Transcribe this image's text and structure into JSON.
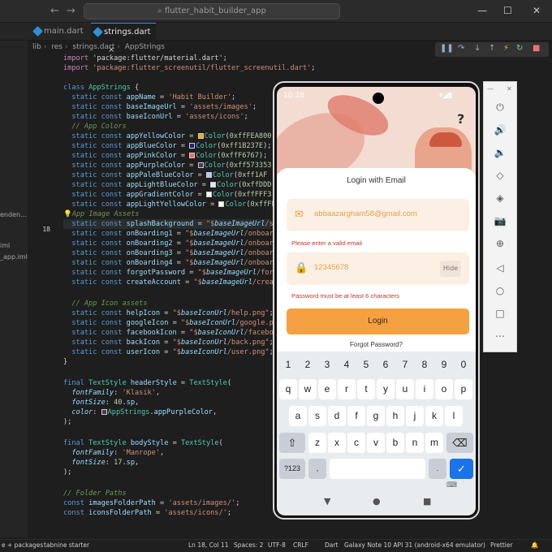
{
  "window": {
    "title": "flutter_habit_builder_app",
    "nav_back": "←",
    "nav_fwd": "→",
    "ctrl_min": "—",
    "ctrl_max": "☐",
    "ctrl_close": "✕"
  },
  "tabs": [
    {
      "label": "main.dart",
      "active": false
    },
    {
      "label": "strings.dart",
      "active": true,
      "close": "×"
    }
  ],
  "breadcrumb": [
    "lib",
    "res",
    "strings.dart",
    "AppStrings"
  ],
  "sidebar_items": [
    "enden...",
    "iml",
    "_app.iml"
  ],
  "editor": {
    "line_numbers": [
      "18"
    ],
    "code": [
      "import 'package:flutter/material.dart';",
      "import 'package:flutter_screenutil/flutter_screenutil.dart';",
      "",
      "class AppStrings {",
      "  static const appName = 'Habit Builder';",
      "  static const baseImageUrl = 'assets/images';",
      "  static const baseIconUrl = 'assets/icons';",
      "  // App Colors",
      "  static const appYellowColor = Color(0xffFEA800",
      "  static const appBlueColor = Color(0xff1B237E);",
      "  static const appPinkColor = Color(0xffF6767);",
      "  static const appPurpleColor = Color(0xff573353",
      "  static const appPaleBlueColor = Color(0xff1AF",
      "  static const appLightBlueColor = Color(0xffDDD",
      "  static const appGradientColor = Color(0xffFFF3",
      "  static const appLightYellowColor = Color(0xffFFF",
      "  // App Image Assets",
      "  static const splashBackground = \"$baseImageUrl/sp",
      "  static const onBoarding1 = \"$baseImageUrl/onboard",
      "  static const onBoarding2 = \"$baseImageUrl/onboard",
      "  static const onBoarding3 = \"$baseImageUrl/onboard",
      "  static const onBoarding4 = \"$baseImageUrl/onboard",
      "  static const forgotPassword = \"$baseImageUrl/forg",
      "  static const createAccount = \"$baseImageUrl/creat",
      "",
      "  // App Icon assets",
      "  static const helpIcon = \"$baseIconUrl/help.png\";",
      "  static const googleIcon = \"$baseIconUrl/google.pn",
      "  static const facebookIcon = \"$baseIconUrl/faceboo",
      "  static const backIcon = \"$baseIconUrl/back.png\";",
      "  static const userIcon = \"$baseIconUrl/user.png\";",
      "}",
      "",
      "final TextStyle headerStyle = TextStyle(",
      "  fontFamily: 'Klasik',",
      "  fontSize: 40.sp,",
      "  color: AppStrings.appPurpleColor,",
      ");",
      "",
      "final TextStyle bodyStyle = TextStyle(",
      "  fontFamily: 'Manrope',",
      "  fontSize: 17.sp,",
      ");",
      "",
      "// Folder Paths",
      "const imagesFolderPath = 'assets/images/';",
      "const iconsFolderPath = 'assets/icons/';"
    ]
  },
  "status_bar": {
    "left": "e + packages",
    "tabnine": "tabnine starter",
    "position": "Ln 18, Col 11",
    "spaces": "Spaces: 2",
    "encoding": "UTF-8",
    "eol": "CRLF",
    "language": "Dart",
    "device": "Galaxy Note 10 API 31 (android-x64 emulator)",
    "prettier": "Prettier"
  },
  "emulator_tools": [
    "⏻",
    "🔊",
    "🔉",
    "◇",
    "◈",
    "📷",
    "⊕",
    "◁",
    "○",
    "□",
    "⋯"
  ],
  "phone": {
    "time": "10:28",
    "help_icon": "?",
    "card_title": "Login with Email",
    "email_value": "abbaazargham58@gmail.com",
    "email_error": "Please enter a valid email",
    "password_value": "12345678",
    "hide_label": "Hide",
    "password_error": "Password must be at least 6 characters",
    "login_label": "Login",
    "forgot_label": "Forgot Password?",
    "keyboard": {
      "numbers": [
        "1",
        "2",
        "3",
        "4",
        "5",
        "6",
        "7",
        "8",
        "9",
        "0"
      ],
      "row1": [
        "q",
        "w",
        "e",
        "r",
        "t",
        "y",
        "u",
        "i",
        "o",
        "p"
      ],
      "row2": [
        "a",
        "s",
        "d",
        "f",
        "g",
        "h",
        "j",
        "k",
        "l"
      ],
      "row3": [
        "z",
        "x",
        "c",
        "v",
        "b",
        "n",
        "m"
      ],
      "shift": "⇧",
      "backspace": "⌫",
      "sym": "?123",
      "comma": ",",
      "period": ".",
      "enter": "✓"
    },
    "nav": [
      "▼",
      "●",
      "■"
    ]
  }
}
